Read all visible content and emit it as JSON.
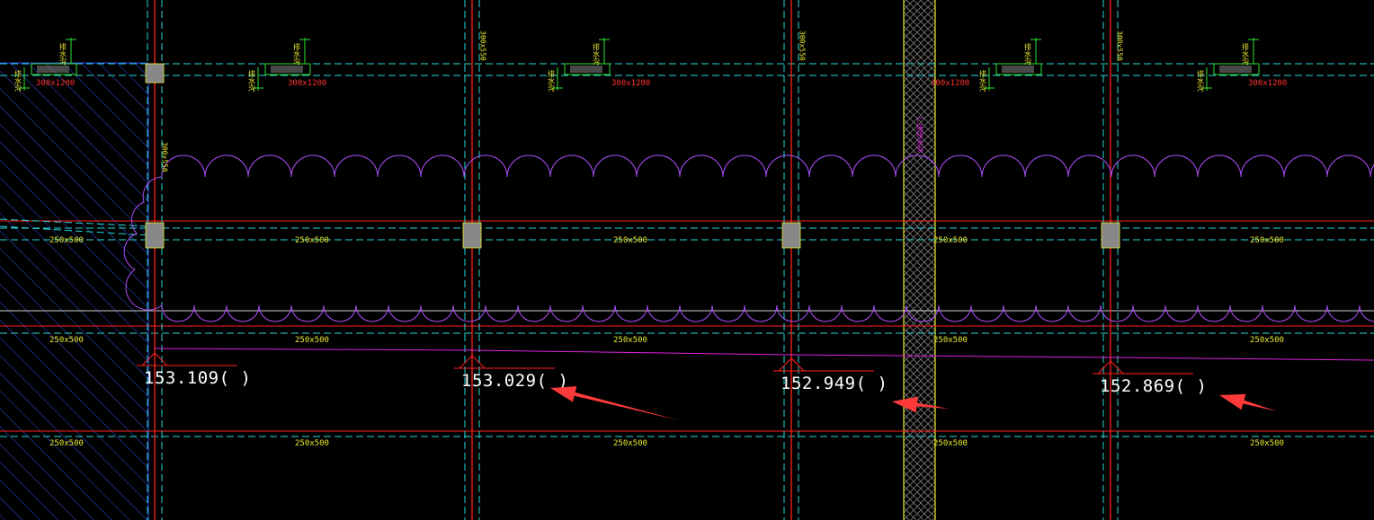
{
  "app": {
    "title": "CAD drawing view"
  },
  "colors": {
    "background": "#000000",
    "grid_red": "#ff2020",
    "beam_cyan": "#29d8d8",
    "beam_white": "#d0d0d0",
    "label_yellow": "#e8e830",
    "label_red": "#ff3030",
    "cloud_magenta": "#b050ff",
    "hatch_blue": "#3050e0",
    "green_symbol": "#30e030",
    "column_gray": "#888888",
    "arrow_red": "#ff3a3a",
    "slope_magenta": "#e020e0",
    "band_yellow": "#e8e830",
    "band_hatch": "#7a7a7a"
  },
  "top_labels": {
    "beam_300x1200": [
      "300x1200",
      "300x1200",
      "300x1200",
      "300x1200",
      "300x1200"
    ],
    "col_300x550": [
      "300x550",
      "300x550",
      "300x550",
      "300x550"
    ]
  },
  "row_labels": {
    "row_mid": [
      "250x500",
      "250x500",
      "250x500",
      "250x500",
      "250x500"
    ],
    "row_low": [
      "250x500",
      "250x500",
      "250x500",
      "250x500",
      "250x500"
    ],
    "row_bottom": [
      "250x500",
      "250x500",
      "250x500",
      "250x500",
      "250x500"
    ]
  },
  "elevations": [
    {
      "text": "153.109( )"
    },
    {
      "text": "153.029( )"
    },
    {
      "text": "152.949( )"
    },
    {
      "text": "152.869( )"
    }
  ],
  "vertical_note": "广场排水沟",
  "symbol_text": "排水沟"
}
